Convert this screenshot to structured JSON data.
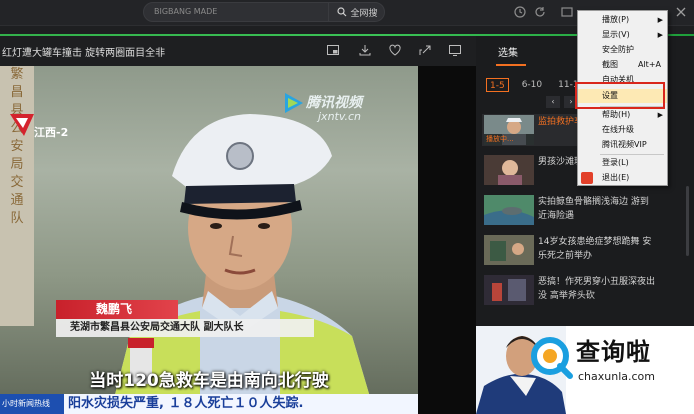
{
  "topbar": {
    "search_placeholder": "BIGBANG MADE",
    "search_button": "全网搜",
    "icons": [
      "history-icon",
      "refresh-icon",
      "minimize-icon",
      "maximize-icon",
      "close-icon"
    ]
  },
  "video": {
    "title": "红灯遭大罐车撞击 旋转两圈面目全非",
    "toolbar_icons": [
      "pip-icon",
      "download-icon",
      "favorite-icon",
      "share-icon",
      "screenshot-icon"
    ],
    "station": "江西-2",
    "watermark": {
      "name": "腾讯视频",
      "sub": "jxntv.cn"
    },
    "name_caption": "魏鹏飞",
    "role_caption": "芜湖市繁昌县公安局交通大队 副大队长",
    "main_caption": "当时120急救车是由南向北行驶",
    "ticker_label": "小时新闻热线",
    "ticker_text": "阳水灾损失严重, １８人死亡１０人失踪."
  },
  "panel": {
    "tab": "选集",
    "episode_ranges": [
      "1-5",
      "6-10",
      "11-15"
    ],
    "nav": [
      "‹",
      "›"
    ],
    "items": [
      {
        "title": "监拍救护车车撞击 旋",
        "playing_label": "播放中...",
        "active": true
      },
      {
        "title": "男孩沙滩玩友愤怒：男子",
        "playing_label": "",
        "active": false
      },
      {
        "title": "实拍鲸鱼骨骼搁浅海边 游到近海险遇",
        "playing_label": "",
        "active": false
      },
      {
        "title": "14岁女孩患绝症梦想跪舞 安乐死之前举办",
        "playing_label": "",
        "active": false
      },
      {
        "title": "恶搞！作死男穿小丑服深夜出没 高举斧头砍",
        "playing_label": "",
        "active": false
      }
    ]
  },
  "menu": {
    "items": [
      {
        "label": "播放(P)",
        "shortcut": "",
        "submenu": true
      },
      {
        "label": "显示(V)",
        "shortcut": "",
        "submenu": true
      },
      {
        "label": "安全防护",
        "shortcut": "",
        "submenu": false
      },
      {
        "label": "截图",
        "shortcut": "Alt+A",
        "submenu": false
      },
      {
        "label": "自动关机",
        "shortcut": "",
        "submenu": false
      },
      {
        "label": "设置",
        "shortcut": "",
        "submenu": false,
        "highlighted": true
      },
      {
        "label": "帮助(H)",
        "shortcut": "",
        "submenu": true
      },
      {
        "label": "在线升级",
        "shortcut": "",
        "submenu": false
      },
      {
        "label": "腾讯视频VIP",
        "shortcut": "",
        "submenu": false
      },
      {
        "label": "登录(L)",
        "shortcut": "",
        "submenu": false
      },
      {
        "label": "退出(E)",
        "shortcut": "",
        "submenu": false
      }
    ]
  },
  "watermark_site": {
    "name": "查询啦",
    "url": "chaxunla.com"
  },
  "colors": {
    "accent": "#f37021",
    "progress": "#3bc356",
    "menu_highlight": "#fde9b4",
    "redbox": "#d9261c"
  }
}
